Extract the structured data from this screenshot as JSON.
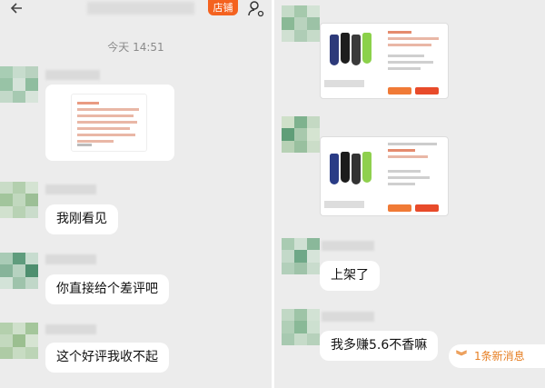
{
  "header": {
    "back_icon": "arrow-left-icon",
    "shop_label": "店铺",
    "profile_icon": "user-settings-icon"
  },
  "timestamp": "今天 14:51",
  "messages_left": [
    {
      "text": "我刚看见"
    },
    {
      "text": "你直接给个差评吧"
    },
    {
      "text": "这个好评我收不起"
    }
  ],
  "messages_right": [
    {
      "text": "上架了"
    },
    {
      "text": "我多赚5.6不香嘛"
    }
  ],
  "new_message": {
    "icon": "double-chevron-down-icon",
    "label": "1条新消息"
  },
  "colors": {
    "accent": "#f4621f",
    "new_message_text": "#e67e22",
    "background": "#ececec",
    "bubble": "#ffffff"
  }
}
